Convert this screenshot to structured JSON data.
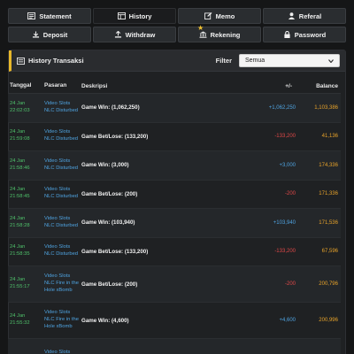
{
  "nav": {
    "row1": [
      {
        "label": "Statement",
        "icon": "statement-icon"
      },
      {
        "label": "History",
        "icon": "history-icon",
        "active": true
      },
      {
        "label": "Memo",
        "icon": "memo-icon"
      },
      {
        "label": "Referal",
        "icon": "user-icon"
      }
    ],
    "row2": [
      {
        "label": "Deposit",
        "icon": "deposit-icon"
      },
      {
        "label": "Withdraw",
        "icon": "withdraw-icon"
      },
      {
        "label": "Rekening",
        "icon": "bank-icon"
      },
      {
        "label": "Password",
        "icon": "lock-icon"
      }
    ]
  },
  "panel": {
    "title": "History Transaksi",
    "filter_label": "Filter",
    "filter_value": "Semua"
  },
  "table": {
    "headers": {
      "date": "Tanggal",
      "game": "Pasaran",
      "desc": "Deskripsi",
      "amount": "+/-",
      "balance": "Balance"
    },
    "rows": [
      {
        "date": "24 Jan 22:02:03",
        "game": "Video Slots NLC Disturbed",
        "desc": "Game Win: (1,062,250)",
        "amount": "+1,062,250",
        "sign": "pos",
        "balance": "1,103,386"
      },
      {
        "date": "24 Jan 21:59:08",
        "game": "Video Slots NLC Disturbed",
        "desc": "Game Bet/Lose: (133,200)",
        "amount": "-133,200",
        "sign": "neg",
        "balance": "41,136"
      },
      {
        "date": "24 Jan 21:58:46",
        "game": "Video Slots NLC Disturbed",
        "desc": "Game Win: (3,000)",
        "amount": "+3,000",
        "sign": "pos",
        "balance": "174,336"
      },
      {
        "date": "24 Jan 21:58:45",
        "game": "Video Slots NLC Disturbed",
        "desc": "Game Bet/Lose: (200)",
        "amount": "-200",
        "sign": "neg",
        "balance": "171,336"
      },
      {
        "date": "24 Jan 21:58:28",
        "game": "Video Slots NLC Disturbed",
        "desc": "Game Win: (103,940)",
        "amount": "+103,940",
        "sign": "pos",
        "balance": "171,536"
      },
      {
        "date": "24 Jan 21:58:35",
        "game": "Video Slots NLC Disturbed",
        "desc": "Game Bet/Lose: (133,200)",
        "amount": "-133,200",
        "sign": "neg",
        "balance": "67,596"
      },
      {
        "date": "24 Jan 21:55:17",
        "game": "Video Slots NLC Fire in the Hole xBomb",
        "desc": "Game Bet/Lose: (200)",
        "amount": "-200",
        "sign": "neg",
        "balance": "200,796"
      },
      {
        "date": "24 Jan 21:55:32",
        "game": "Video Slots NLC Fire in the Hole xBomb",
        "desc": "Game Win: (4,600)",
        "amount": "+4,600",
        "sign": "pos",
        "balance": "200,996"
      },
      {
        "date": "",
        "game": "Video Slots",
        "desc": "",
        "amount": "",
        "sign": "pos",
        "balance": ""
      }
    ]
  }
}
